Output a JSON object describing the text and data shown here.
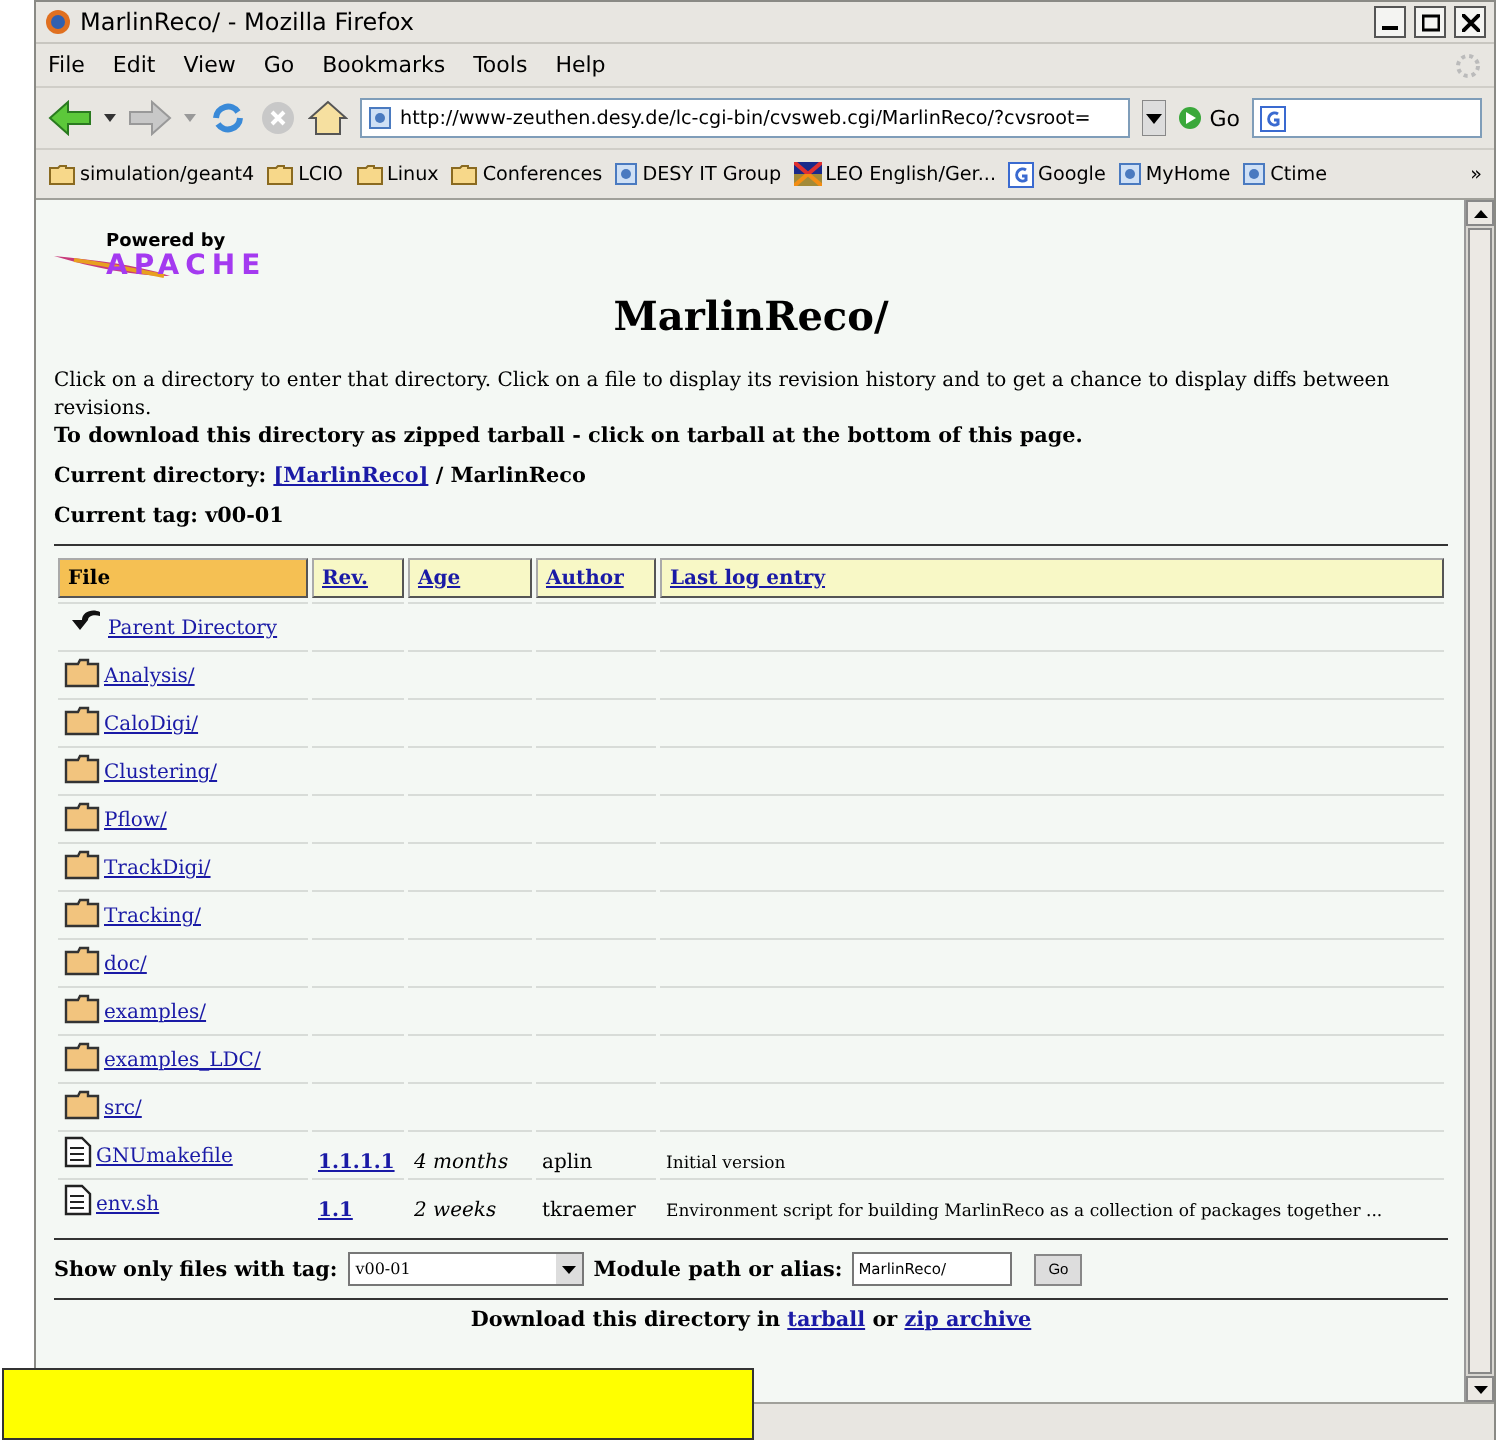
{
  "window": {
    "title": "MarlinReco/ - Mozilla Firefox"
  },
  "menu": [
    "File",
    "Edit",
    "View",
    "Go",
    "Bookmarks",
    "Tools",
    "Help"
  ],
  "toolbar": {
    "address": "http://www-zeuthen.desy.de/lc-cgi-bin/cvsweb.cgi/MarlinReco/?cvsroot=",
    "go": "Go"
  },
  "bookmarks": [
    {
      "label": "simulation/geant4",
      "kind": "folder"
    },
    {
      "label": "LCIO",
      "kind": "folder"
    },
    {
      "label": "Linux",
      "kind": "folder"
    },
    {
      "label": "Conferences",
      "kind": "folder"
    },
    {
      "label": "DESY IT Group",
      "kind": "site"
    },
    {
      "label": "LEO English/Ger...",
      "kind": "flag"
    },
    {
      "label": "Google",
      "kind": "google"
    },
    {
      "label": "MyHome",
      "kind": "site"
    },
    {
      "label": "Ctime",
      "kind": "site"
    }
  ],
  "bookmarks_more": "»",
  "page": {
    "logo": {
      "top": "Powered by",
      "bottom": "APACHE"
    },
    "heading": "MarlinReco/",
    "intro": "Click on a directory to enter that directory. Click on a file to display its revision history and to get a chance to display diffs between revisions.",
    "download_note": "To download this directory as zipped tarball - click on tarball at the bottom of this page.",
    "current_directory": {
      "label": "Current directory:",
      "link": "[MarlinReco]",
      "rest": "/ MarlinReco"
    },
    "current_tag": "Current tag: v00-01",
    "table": {
      "columns": [
        {
          "label": "File",
          "selected": true
        },
        {
          "label": "Rev.",
          "selected": false
        },
        {
          "label": "Age",
          "selected": false
        },
        {
          "label": "Author",
          "selected": false
        },
        {
          "label": "Last log entry",
          "selected": false
        }
      ],
      "rows": [
        {
          "kind": "parent",
          "name": "Parent Directory"
        },
        {
          "kind": "folder",
          "name": "Analysis/"
        },
        {
          "kind": "folder",
          "name": "CaloDigi/"
        },
        {
          "kind": "folder",
          "name": "Clustering/"
        },
        {
          "kind": "folder",
          "name": "Pflow/"
        },
        {
          "kind": "folder",
          "name": "TrackDigi/"
        },
        {
          "kind": "folder",
          "name": "Tracking/"
        },
        {
          "kind": "folder",
          "name": "doc/"
        },
        {
          "kind": "folder",
          "name": "examples/"
        },
        {
          "kind": "folder",
          "name": "examples_LDC/"
        },
        {
          "kind": "folder",
          "name": "src/"
        },
        {
          "kind": "file",
          "name": "GNUmakefile",
          "rev": "1.1.1.1",
          "age": "4 months",
          "author": "aplin",
          "log": "Initial version"
        },
        {
          "kind": "file",
          "name": "env.sh",
          "rev": "1.1",
          "age": "2 weeks",
          "author": "tkraemer",
          "log": "Environment script for building MarlinReco as a collection of packages together ..."
        }
      ]
    },
    "filter": {
      "tag_label": "Show only files with tag:",
      "tag_value": "v00-01",
      "module_label": "Module path or alias:",
      "module_value": "MarlinReco/",
      "button": "Go"
    },
    "download": {
      "prefix": "Download this directory in",
      "link1": "tarball",
      "middle": "or",
      "link2": "zip archive"
    }
  }
}
